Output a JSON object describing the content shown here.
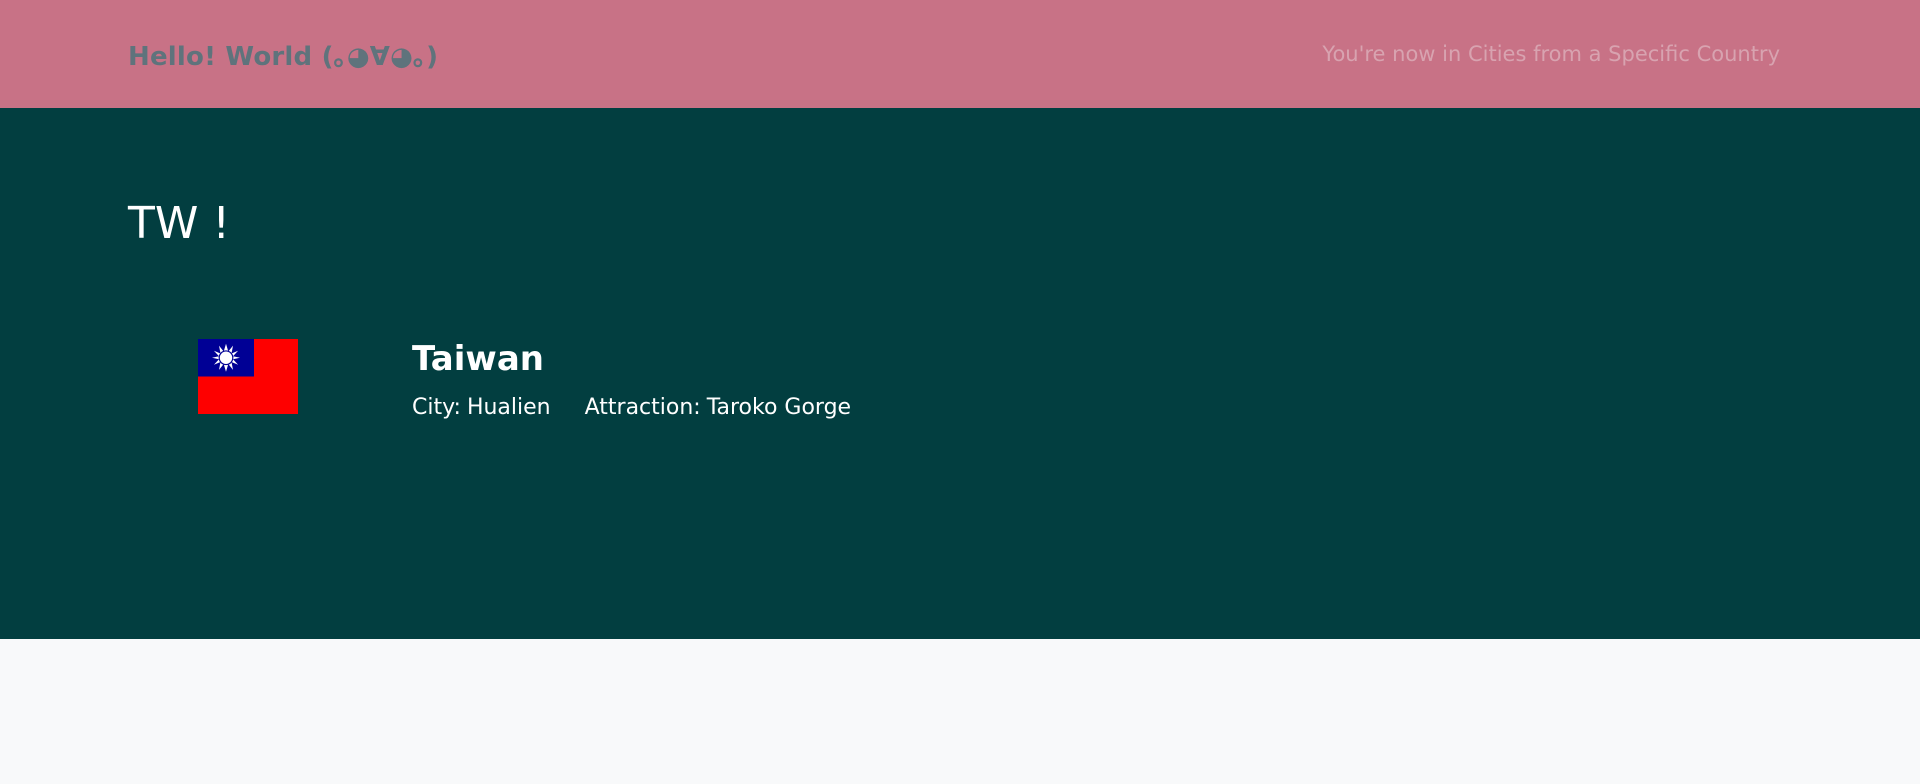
{
  "navbar": {
    "brand": "Hello! World (｡◕∀◕｡)",
    "status": "You're now in Cities from a Specific Country"
  },
  "main": {
    "title": "TW !",
    "country": {
      "flag_icon": "taiwan-flag-icon",
      "name": "Taiwan",
      "city_label": "City:",
      "city": "Hualien",
      "attraction_label": "Attraction:",
      "attraction": "Taroko Gorge"
    }
  },
  "colors": {
    "navbar": "#c87286",
    "brand": "#5f737c",
    "status": "#d8a3b0",
    "hero": "#023e40",
    "page": "#f8f9fa",
    "text": "#ffffff",
    "flag_red": "#fe0000",
    "flag_blue": "#000095"
  }
}
